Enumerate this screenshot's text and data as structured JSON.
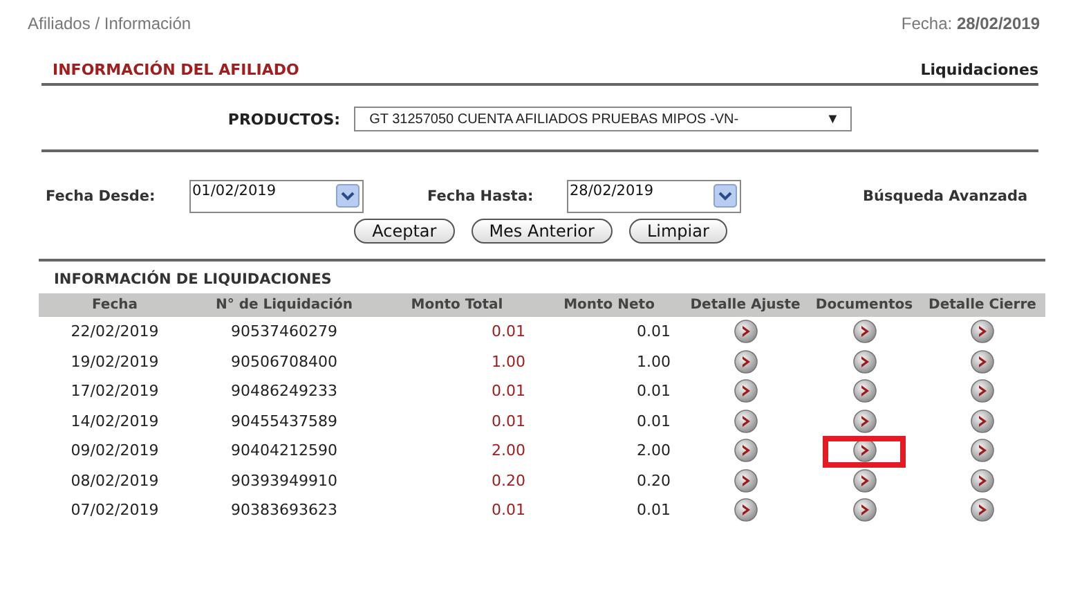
{
  "breadcrumb": "Afiliados / Información",
  "date": {
    "label": "Fecha:",
    "value": "28/02/2019"
  },
  "section_title": "INFORMACIÓN DEL AFILIADO",
  "section_link": "Liquidaciones",
  "products": {
    "label": "PRODUCTOS:",
    "value": "GT 31257050 CUENTA AFILIADOS PRUEBAS MIPOS -VN-",
    "arrow": "▼"
  },
  "date_from": {
    "label": "Fecha Desde:",
    "value": "01/02/2019"
  },
  "date_to": {
    "label": "Fecha Hasta:",
    "value": "28/02/2019"
  },
  "advanced_search": "Búsqueda Avanzada",
  "buttons": [
    "Aceptar",
    "Mes Anterior",
    "Limpiar"
  ],
  "table": {
    "title": "INFORMACIÓN DE LIQUIDACIONES",
    "columns": [
      "Fecha",
      "N° de Liquidación",
      "Monto Total",
      "Monto Neto",
      "Detalle Ajuste",
      "Documentos",
      "Detalle Cierre"
    ],
    "rows": [
      {
        "fecha": "22/02/2019",
        "liquidacion": "90537460279",
        "monto_total": "0.01",
        "monto_neto": "0.01",
        "highlighted": false
      },
      {
        "fecha": "19/02/2019",
        "liquidacion": "90506708400",
        "monto_total": "1.00",
        "monto_neto": "1.00",
        "highlighted": false
      },
      {
        "fecha": "17/02/2019",
        "liquidacion": "90486249233",
        "monto_total": "0.01",
        "monto_neto": "0.01",
        "highlighted": false
      },
      {
        "fecha": "14/02/2019",
        "liquidacion": "90455437589",
        "monto_total": "0.01",
        "monto_neto": "0.01",
        "highlighted": false
      },
      {
        "fecha": "09/02/2019",
        "liquidacion": "90404212590",
        "monto_total": "2.00",
        "monto_neto": "2.00",
        "highlighted": true
      },
      {
        "fecha": "08/02/2019",
        "liquidacion": "90393949910",
        "monto_total": "0.20",
        "monto_neto": "0.20",
        "highlighted": false
      },
      {
        "fecha": "07/02/2019",
        "liquidacion": "90383693623",
        "monto_total": "0.01",
        "monto_neto": "0.01",
        "highlighted": false
      }
    ]
  }
}
